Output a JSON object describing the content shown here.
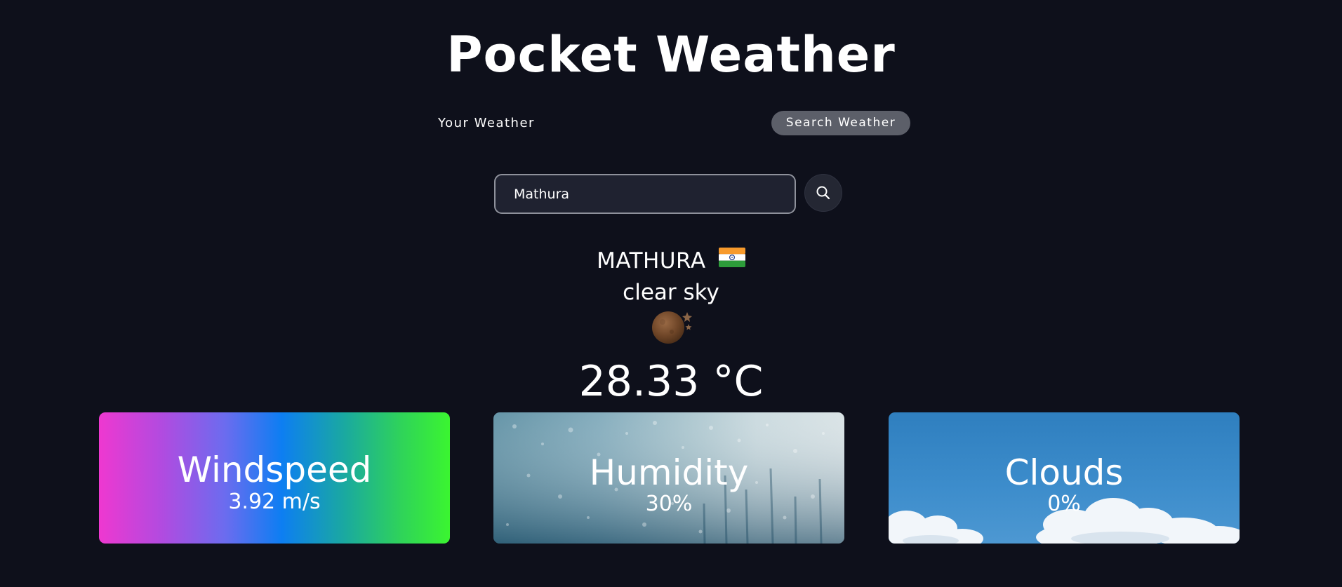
{
  "app": {
    "title": "Pocket Weather"
  },
  "tabs": [
    {
      "label": "Your Weather",
      "active": false
    },
    {
      "label": "Search Weather",
      "active": true
    }
  ],
  "search": {
    "value": "Mathura",
    "button_icon": "search-icon"
  },
  "weather": {
    "city": "MATHURA",
    "country_flag": "india-flag-icon",
    "description": "clear sky",
    "icon": "moon-stars-icon",
    "temperature": "28.33 °C"
  },
  "stats": [
    {
      "label": "Windspeed",
      "value": "3.92 m/s"
    },
    {
      "label": "Humidity",
      "value": "30%"
    },
    {
      "label": "Clouds",
      "value": "0%"
    }
  ],
  "colors": {
    "background": "#0e101b",
    "active_tab_bg": "#5c5f69",
    "input_bg": "#1f2230"
  }
}
